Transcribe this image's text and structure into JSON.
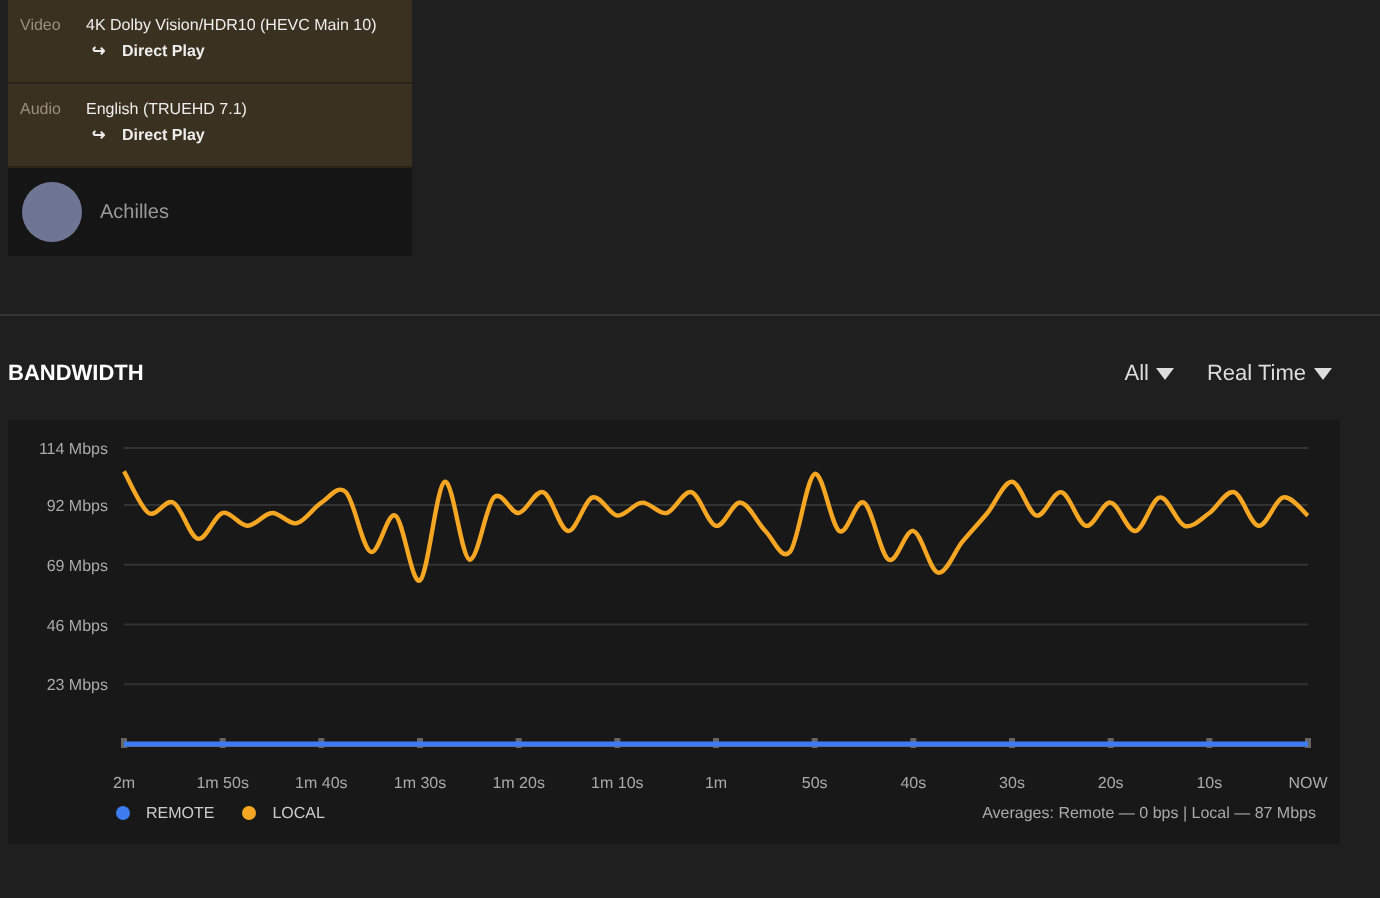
{
  "streams": [
    {
      "label": "Video",
      "value": "4K Dolby Vision/HDR10 (HEVC Main 10)",
      "arrow": "↪",
      "decision": "Direct Play"
    },
    {
      "label": "Audio",
      "value": "English (TRUEHD 7.1)",
      "arrow": "↪",
      "decision": "Direct Play"
    }
  ],
  "user": {
    "name": "Achilles"
  },
  "bandwidth": {
    "title": "BANDWIDTH",
    "filters": [
      "All",
      "Real Time"
    ],
    "chart_data": {
      "type": "line",
      "categories": [
        "2m",
        null,
        null,
        null,
        "1m 50s",
        null,
        null,
        null,
        "1m 40s",
        null,
        null,
        null,
        "1m 30s",
        null,
        null,
        null,
        "1m 20s",
        null,
        null,
        null,
        "1m 10s",
        null,
        null,
        null,
        "1m",
        null,
        null,
        null,
        "50s",
        null,
        null,
        null,
        "40s",
        null,
        null,
        null,
        "30s",
        null,
        null,
        null,
        "20s",
        null,
        null,
        null,
        "10s",
        null,
        null,
        null,
        "NOW"
      ],
      "series": [
        {
          "name": "REMOTE",
          "color": "#3d7bf0",
          "values": [
            0,
            0,
            0,
            0,
            0,
            0,
            0,
            0,
            0,
            0,
            0,
            0,
            0,
            0,
            0,
            0,
            0,
            0,
            0,
            0,
            0,
            0,
            0,
            0,
            0,
            0,
            0,
            0,
            0,
            0,
            0,
            0,
            0,
            0,
            0,
            0,
            0,
            0,
            0,
            0,
            0,
            0,
            0,
            0,
            0,
            0,
            0,
            0,
            0
          ]
        },
        {
          "name": "LOCAL",
          "color": "#f5a623",
          "values": [
            105,
            89,
            93,
            79,
            89,
            84,
            89,
            85,
            93,
            97,
            74,
            88,
            63,
            101,
            71,
            95,
            89,
            97,
            82,
            95,
            88,
            93,
            89,
            97,
            84,
            93,
            82,
            74,
            104,
            82,
            93,
            71,
            82,
            66,
            78,
            89,
            101,
            88,
            97,
            84,
            93,
            82,
            95,
            84,
            89,
            97,
            84,
            95,
            88
          ]
        }
      ],
      "grid": true,
      "ylim": [
        0,
        114
      ],
      "yticks": [
        {
          "value": 23,
          "label": "23 Mbps"
        },
        {
          "value": 46,
          "label": "46 Mbps"
        },
        {
          "value": 69,
          "label": "69 Mbps"
        },
        {
          "value": 92,
          "label": "92 Mbps"
        },
        {
          "value": 114,
          "label": "114 Mbps"
        }
      ]
    },
    "averages": "Averages: Remote — 0 bps | Local — 87 Mbps"
  }
}
